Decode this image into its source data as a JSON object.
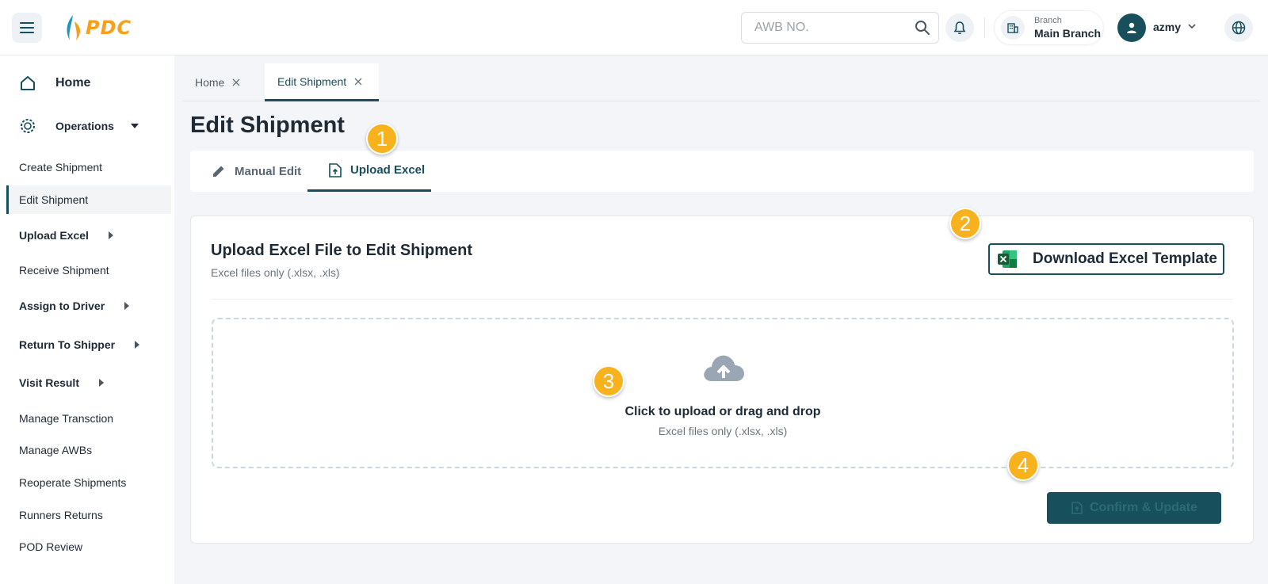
{
  "header": {
    "logo_text": "PDC",
    "search_placeholder": "AWB NO.",
    "branch_label": "Branch",
    "branch_value": "Main Branch",
    "username": "azmy"
  },
  "sidebar": {
    "home": "Home",
    "operations": "Operations",
    "items": [
      {
        "label": "Create Shipment"
      },
      {
        "label": "Edit Shipment"
      },
      {
        "label": "Upload Excel"
      },
      {
        "label": "Receive Shipment"
      },
      {
        "label": "Assign to Driver"
      },
      {
        "label": "Return To Shipper"
      },
      {
        "label": "Visit Result"
      },
      {
        "label": "Manage Transction"
      },
      {
        "label": "Manage AWBs"
      },
      {
        "label": "Reoperate Shipments"
      },
      {
        "label": "Runners Returns"
      },
      {
        "label": "POD Review"
      }
    ]
  },
  "tabs": [
    {
      "label": "Home"
    },
    {
      "label": "Edit Shipment"
    }
  ],
  "page": {
    "title": "Edit Shipment",
    "subtabs": [
      {
        "label": "Manual Edit"
      },
      {
        "label": "Upload Excel"
      }
    ]
  },
  "upload": {
    "title": "Upload Excel File to Edit Shipment",
    "subtitle": "Excel files only (.xlsx, .xls)",
    "download_label": "Download Excel Template",
    "drop_title": "Click to upload or drag and drop",
    "drop_sub": "Excel files only (.xlsx, .xls)",
    "confirm_label": "Confirm & Update"
  },
  "steps": [
    "1",
    "2",
    "3",
    "4"
  ],
  "colors": {
    "primary": "#17505c",
    "accent": "#f7b21d",
    "logo": "#f5a11c"
  }
}
